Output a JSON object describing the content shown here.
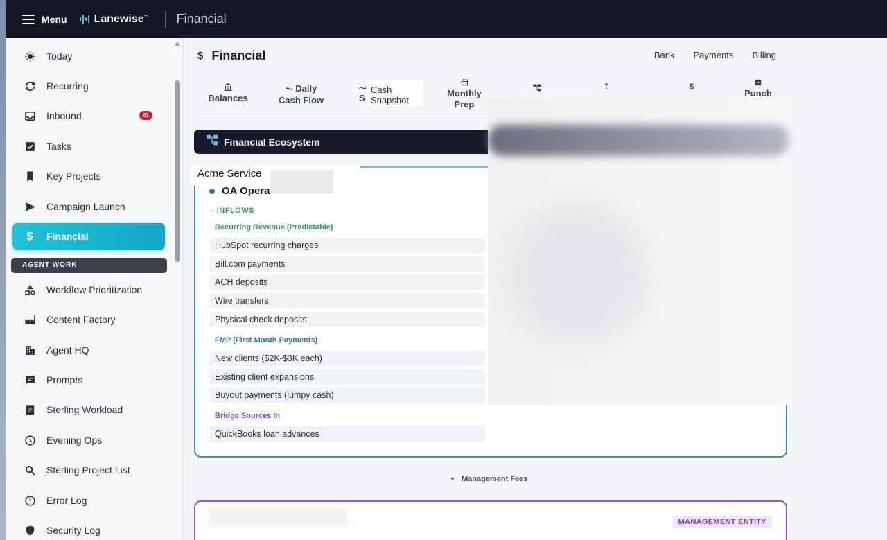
{
  "topbar": {
    "menu_label": "Menu",
    "brand": "Lanewise",
    "brand_mark": "™",
    "section_title": "Financial"
  },
  "sidebar": {
    "items": [
      {
        "label": "Today",
        "icon": "sun-icon"
      },
      {
        "label": "Recurring",
        "icon": "refresh-icon"
      },
      {
        "label": "Inbound",
        "icon": "inbox-icon",
        "badge": "61"
      },
      {
        "label": "Tasks",
        "icon": "checkbox-icon"
      },
      {
        "label": "Key Projects",
        "icon": "bookmark-icon"
      },
      {
        "label": "Campaign Launch",
        "icon": "send-icon"
      },
      {
        "label": "Financial",
        "icon": "dollar-icon",
        "active": true
      }
    ],
    "section_header": "AGENT WORK",
    "agent_items": [
      {
        "label": "Workflow Prioritization",
        "icon": "shapes-icon"
      },
      {
        "label": "Content Factory",
        "icon": "factory-icon"
      },
      {
        "label": "Agent HQ",
        "icon": "building-icon"
      },
      {
        "label": "Prompts",
        "icon": "chat-icon"
      },
      {
        "label": "Sterling Workload",
        "icon": "document-icon"
      },
      {
        "label": "Evening Ops",
        "icon": "clock-icon"
      },
      {
        "label": "Sterling Project List",
        "icon": "search-icon"
      },
      {
        "label": "Error Log",
        "icon": "alert-icon"
      },
      {
        "label": "Security Log",
        "icon": "shield-icon"
      }
    ],
    "active_color": "#1ec2d9"
  },
  "header": {
    "dollar": "$",
    "title": "Financial",
    "links": [
      "Bank",
      "Payments",
      "Billing"
    ]
  },
  "tabs": {
    "balances_line1": "Balances",
    "daily_line1": "Daily",
    "daily_line2": "Cash Flow",
    "partial": "S",
    "snapshot_line1": "Cash",
    "snapshot_line2": "Snapshot",
    "monthly_line1": "Monthly",
    "monthly_line2": "Prep",
    "dollar": "$",
    "punch": "Punch"
  },
  "ecosystem": {
    "title": "Financial Ecosystem",
    "entity_label": "Acme Service",
    "op_title": "OA Opera",
    "inflows_label": "INFLOWS",
    "groups": {
      "recurring": "Recurring Revenue (Predictable)",
      "fmp": "FMP (First Month Payments)",
      "bridge": "Bridge Sources In"
    },
    "recurring_rows": [
      "HubSpot recurring charges",
      "Bill.com payments",
      "ACH deposits",
      "Wire transfers",
      "Physical check deposits"
    ],
    "fmp_rows": [
      "New clients ($2K-$3K each)",
      "Existing client expansions",
      "Buyout payments (lumpy cash)"
    ],
    "bridge_rows": [
      "QuickBooks loan advances"
    ]
  },
  "management": {
    "fees_label": "Management Fees",
    "entity_badge": "MANAGEMENT ENTITY"
  },
  "colors": {
    "topbar": "#141722",
    "accent": "#1ec2d9",
    "inflow_green": "#2a9e55",
    "fmp_blue": "#2a6ccf",
    "bridge_purple": "#8a3fd0",
    "badge_red": "#d7232b"
  }
}
